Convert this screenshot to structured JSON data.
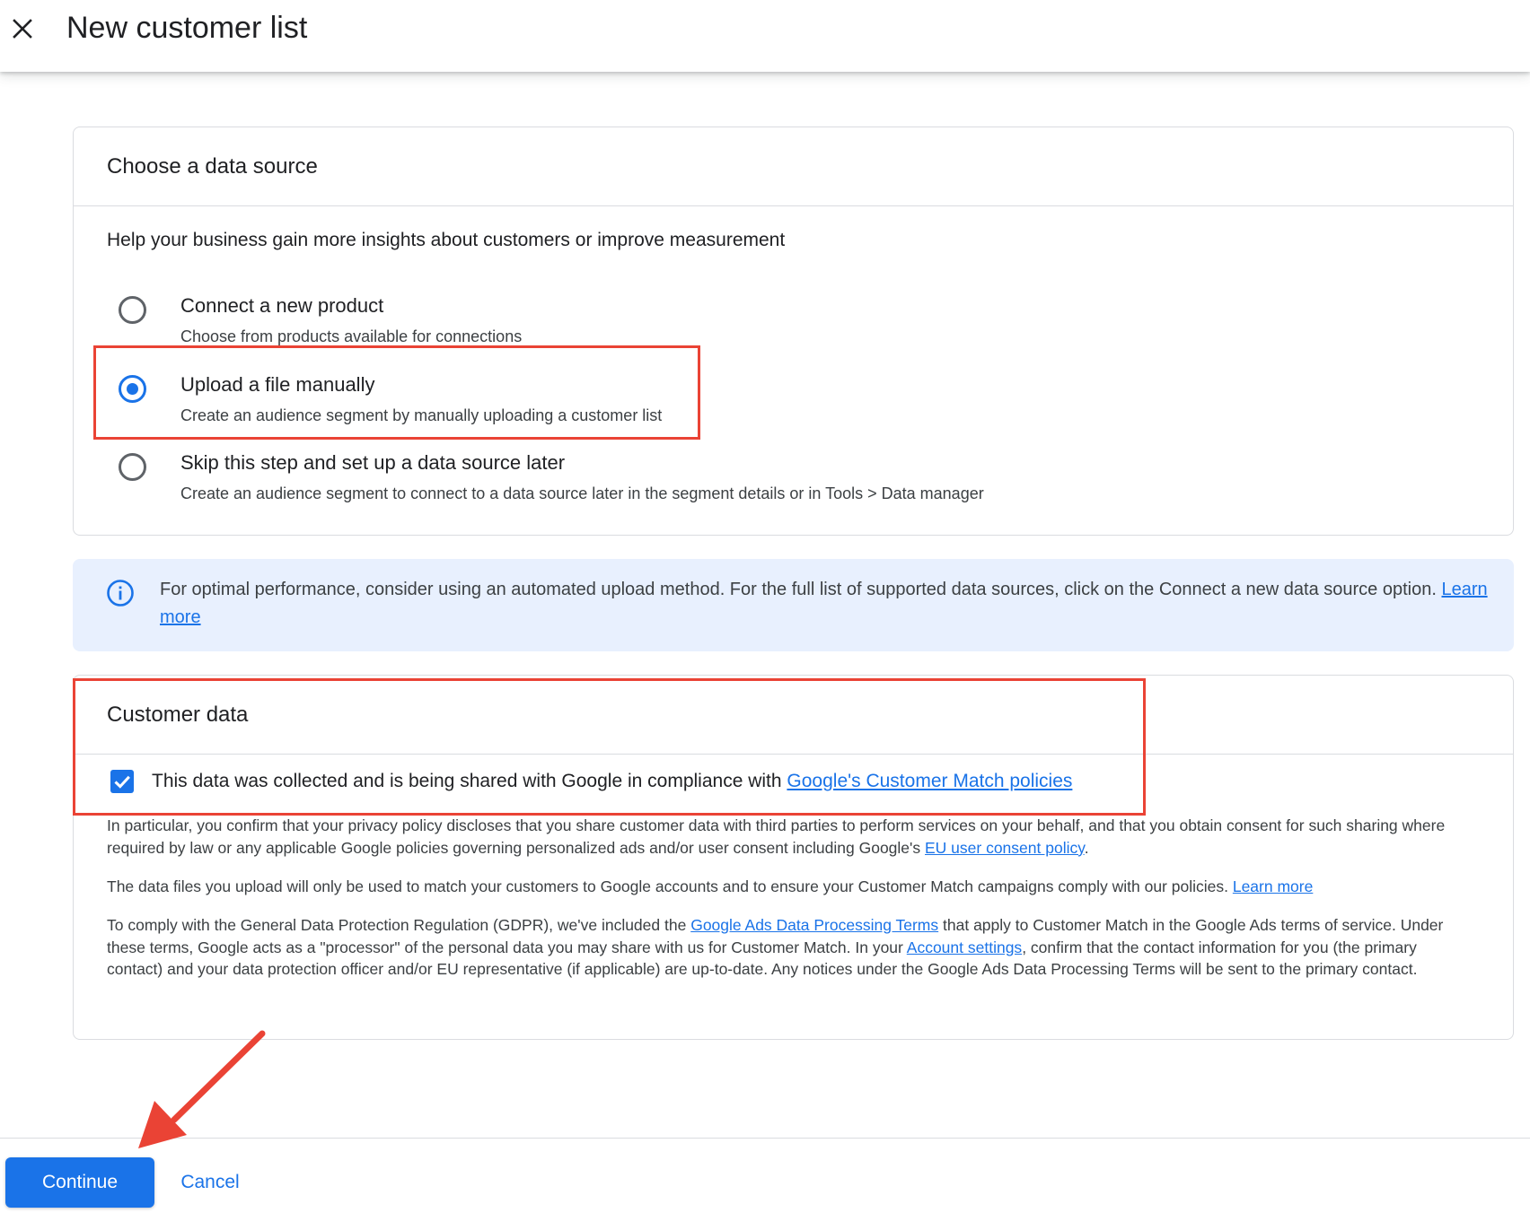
{
  "header": {
    "title": "New customer list",
    "close_icon": "close-icon"
  },
  "data_source": {
    "title": "Choose a data source",
    "subtitle": "Help your business gain more insights about customers or improve measurement",
    "options": [
      {
        "label": "Connect a new product",
        "description": "Choose from products available for connections",
        "selected": false
      },
      {
        "label": "Upload a file manually",
        "description": "Create an audience segment by manually uploading a customer list",
        "selected": true
      },
      {
        "label": "Skip this step and set up a data source later",
        "description": "Create an audience segment to connect to a data source later in the segment details or in Tools > Data manager",
        "selected": false
      }
    ]
  },
  "info_banner": {
    "icon": "info-icon",
    "text": "For optimal performance, consider using an automated upload method. For the full list of supported data sources, click on the Connect a new data source option.",
    "link": "Learn more"
  },
  "customer_data": {
    "title": "Customer data",
    "checkbox_checked": true,
    "checkbox_text": "This data was collected and is being shared with Google in compliance with",
    "checkbox_link": "Google's Customer Match policies",
    "paragraph_1": "In particular, you confirm that your privacy policy discloses that you share customer data with third parties to perform services on your behalf, and that you obtain consent for such sharing where required by law or any applicable Google policies governing personalized ads and/or user consent including Google's",
    "paragraph_1_link": "EU user consent policy",
    "paragraph_2": "The data files you upload will only be used to match your customers to Google accounts and to ensure your Customer Match campaigns comply with our policies.",
    "paragraph_2_link": "Learn more",
    "paragraph_3_a": "To comply with the General Data Protection Regulation (GDPR), we've included the",
    "paragraph_3_link_1": "Google Ads Data Processing Terms",
    "paragraph_3_b": "that apply to Customer Match in the Google Ads terms of service. Under these terms, Google acts as a \"processor\" of the personal data you may share with us for Customer Match. In your",
    "paragraph_3_link_2": "Account settings",
    "paragraph_3_c": ", confirm that the contact information for you (the primary contact) and your data protection officer and/or EU representative (if applicable) are up-to-date. Any notices under the Google Ads Data Processing Terms will be sent to the primary contact."
  },
  "footer": {
    "continue_label": "Continue",
    "cancel_label": "Cancel"
  },
  "colors": {
    "accent": "#1a73e8",
    "annotation": "#ea4335",
    "info_background": "#e8f0fe"
  }
}
